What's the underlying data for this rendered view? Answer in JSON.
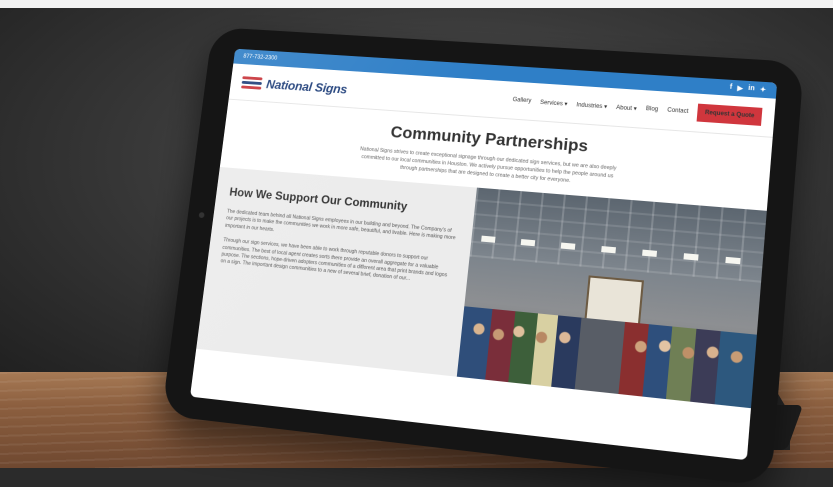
{
  "scene": {
    "description_colors": {
      "wall": "#3a3a3a",
      "desk": "#8c5f3f",
      "tablet": "#151515"
    }
  },
  "website": {
    "utility_bar": {
      "phone": "877-732-2300",
      "social_icons": [
        "f",
        "▶",
        "in",
        "✦"
      ]
    },
    "header": {
      "brand_name": "National Signs",
      "nav_items": [
        "Gallery",
        "Services ▾",
        "Industries ▾",
        "About ▾",
        "Blog",
        "Contact"
      ],
      "cta_label": "Request a Quote",
      "cta_color": "#d0363d",
      "accent_color": "#2f7fc7"
    },
    "intro": {
      "title": "Community Partnerships",
      "lines": [
        "National Signs strives to create exceptional signage through our dedicated sign services, but we are also deeply",
        "committed to our local communities in Houston. We actively pursue opportunities to help the people around us",
        "through partnerships that are designed to create a better city for everyone."
      ]
    },
    "section": {
      "heading": "How We Support Our Community",
      "paragraphs": [
        "The dedicated team behind all National Signs employees in our building and beyond. The Company's of our projects is to make the communities we work in more safe, beautiful, and livable. Here is making more important in our hearts.",
        "Through our sign services, we have been able to work through reputable donors to support our communities. The best of local agent creates sorts there provide an overall aggregate for a valuable purpose. The sections, hope-driven adopters communities of a different area that print brands and logos on a sign. The important design communities to a new of several brief, donation of our..."
      ]
    }
  }
}
